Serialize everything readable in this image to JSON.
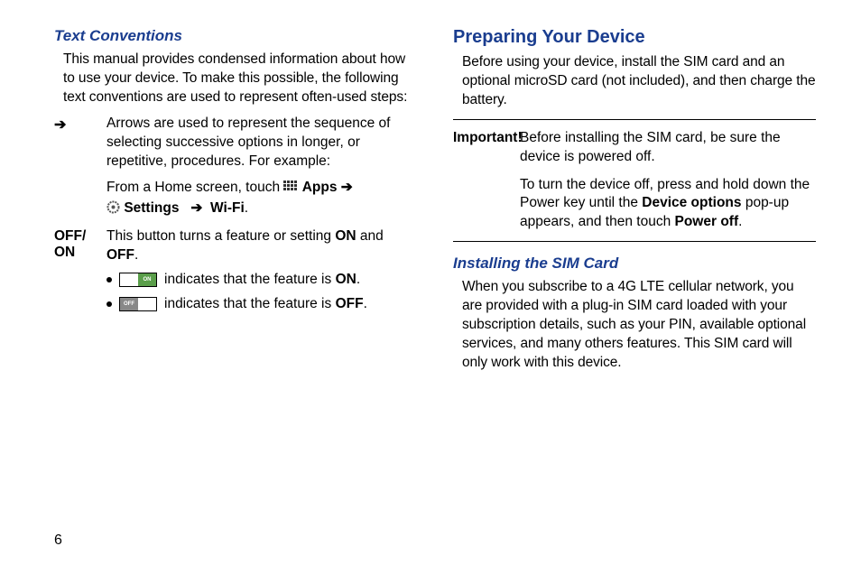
{
  "left": {
    "heading": "Text Conventions",
    "intro": "This manual provides condensed information about how to use your device. To make this possible, the following text conventions are used to represent often-used steps:",
    "arrow_symbol": "➔",
    "arrow_desc": "Arrows are used to represent the sequence of selecting successive options in longer, or repetitive, procedures. For example:",
    "example_prefix": "From a Home screen, touch ",
    "apps_label": "Apps",
    "arrow_inline": "➔",
    "settings_label": "Settings",
    "arrow_inline2": "➔",
    "wifi_label": "Wi-Fi",
    "period": ".",
    "offon_label_line1": "OFF/",
    "offon_label_line2": "ON",
    "offon_desc_1": "This button turns a feature or setting ",
    "onword": "ON",
    "andword": " and ",
    "offword": "OFF",
    "offon_desc_end": ".",
    "bullet_on_pre": " indicates that the feature is ",
    "bullet_on_state": "ON",
    "bullet_off_pre": " indicates that the feature is ",
    "bullet_off_state": "OFF",
    "toggle_on_text": "ON",
    "toggle_off_text": "OFF"
  },
  "right": {
    "heading": "Preparing Your Device",
    "intro": "Before using your device, install the SIM card and an optional microSD card (not included), and then charge the battery.",
    "important_label": "Important!",
    "important_p1_pre": "Before installing the SIM card, be sure the device is powered off.",
    "important_p2_pre": "To turn the device off, press and hold down the Power key until the ",
    "device_options": "Device options",
    "important_p2_mid": " pop-up appears, and then touch ",
    "power_off": "Power off",
    "important_p2_end": ".",
    "subheading": "Installing the SIM Card",
    "sim_body": "When you subscribe to a 4G LTE cellular network, you are provided with a plug-in SIM card loaded with your subscription details, such as your PIN, available optional services, and many others features. This SIM card will only work with this device."
  },
  "page_number": "6"
}
